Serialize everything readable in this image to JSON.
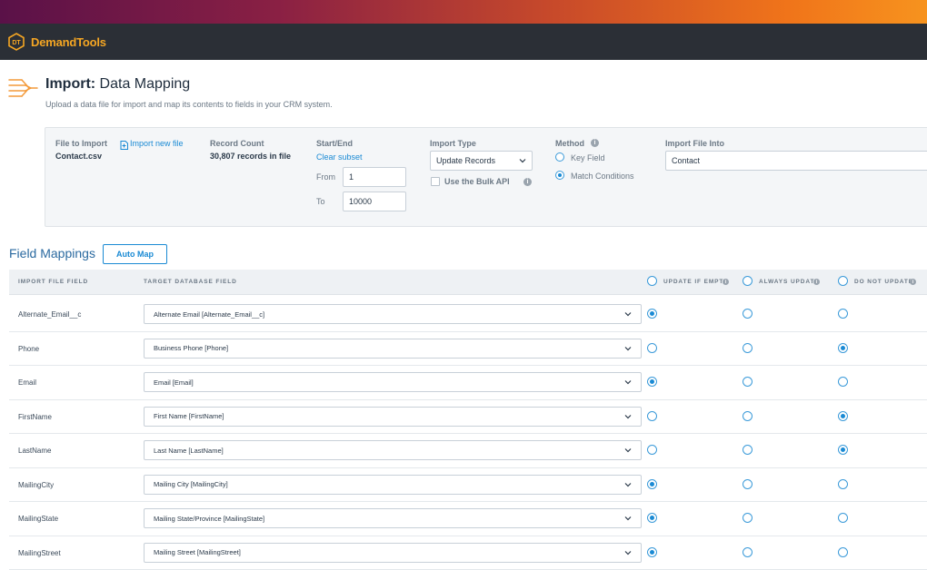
{
  "app": {
    "name": "DemandTools",
    "logo_mark": "DT",
    "accent_color": "#f5a623"
  },
  "header": {
    "title_bold": "Import:",
    "title_rest": " Data Mapping",
    "subtitle": "Upload a data file for import and map its contents to fields in your CRM system."
  },
  "settings": {
    "file_to_import_label": "File to Import",
    "import_new_file_link": "Import new file",
    "file_name": "Contact.csv",
    "record_count_label": "Record Count",
    "record_count_value": "30,807 records in file",
    "start_end_label": "Start/End",
    "clear_subset_link": "Clear subset",
    "from_label": "From",
    "from_value": "1",
    "to_label": "To",
    "to_value": "10000",
    "import_type_label": "Import Type",
    "import_type_value": "Update Records",
    "bulk_api_label": "Use the Bulk API",
    "bulk_api_checked": false,
    "method_label": "Method",
    "method_options": [
      {
        "label": "Key Field",
        "selected": false
      },
      {
        "label": "Match Conditions",
        "selected": true
      }
    ],
    "import_into_label": "Import File Into",
    "import_into_value": "Contact"
  },
  "field_mappings": {
    "title": "Field Mappings",
    "auto_map_label": "Auto Map",
    "columns": {
      "import_field": "Import File Field",
      "target_field": "Target Database Field",
      "update_if_empty": "Update if empty",
      "always_update": "Always update",
      "do_not_update": "Do not update"
    },
    "rows": [
      {
        "import_field": "Alternate_Email__c",
        "target": "Alternate Email [Alternate_Email__c]",
        "mode": "update_if_empty"
      },
      {
        "import_field": "Phone",
        "target": "Business Phone [Phone]",
        "mode": "do_not_update"
      },
      {
        "import_field": "Email",
        "target": "Email [Email]",
        "mode": "update_if_empty"
      },
      {
        "import_field": "FirstName",
        "target": "First Name [FirstName]",
        "mode": "do_not_update"
      },
      {
        "import_field": "LastName",
        "target": "Last Name [LastName]",
        "mode": "do_not_update"
      },
      {
        "import_field": "MailingCity",
        "target": "Mailing City [MailingCity]",
        "mode": "update_if_empty"
      },
      {
        "import_field": "MailingState",
        "target": "Mailing State/Province [MailingState]",
        "mode": "update_if_empty"
      },
      {
        "import_field": "MailingStreet",
        "target": "Mailing Street [MailingStreet]",
        "mode": "update_if_empty"
      }
    ]
  }
}
